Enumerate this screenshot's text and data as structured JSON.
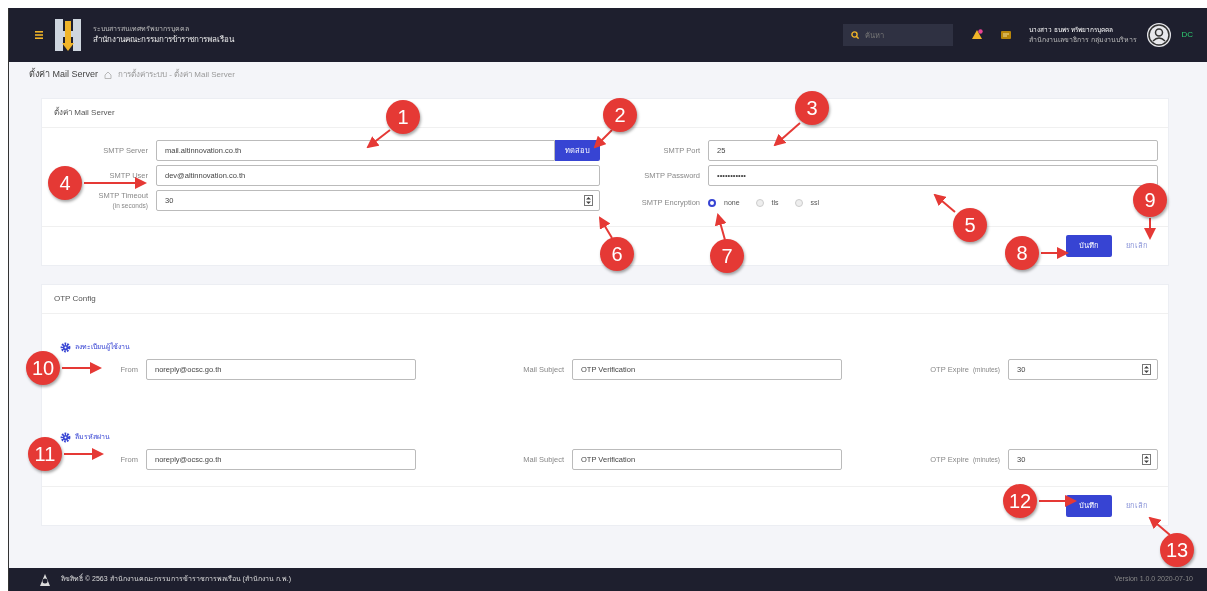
{
  "header": {
    "org_caption": "ระบบสารสนเทศทรัพยากรบุคคล",
    "org_name": "สำนักงานคณะกรรมการข้าราชการพลเรือน",
    "search": {
      "placeholder": "ค้นหา"
    },
    "user": {
      "name": "นางสาว ธนพร ทรัพยากรบุคคล",
      "unit": "สำนักงานเลขาธิการ กลุ่มงานบริหาร",
      "initials": "DC"
    }
  },
  "breadcrumb": {
    "title": "ตั้งค่า Mail Server",
    "path": "การตั้งค่าระบบ - ตั้งค่า Mail Server"
  },
  "mail_server": {
    "title": "ตั้งค่า Mail Server",
    "left_fields": [
      {
        "label": "SMTP Server",
        "value": "mail.altinnovation.co.th",
        "kind": "button",
        "button": "ทดสอบ"
      },
      {
        "label": "SMTP User",
        "value": "dev@altinnovation.co.th",
        "kind": "text"
      },
      {
        "label": "SMTP Timeout",
        "sublabel": "(in seconds)",
        "value": "30",
        "kind": "number"
      }
    ],
    "right_fields": [
      {
        "label": "SMTP Port",
        "value": "25",
        "kind": "text"
      },
      {
        "label": "SMTP Password",
        "value": "•••••••••••",
        "kind": "text"
      }
    ],
    "encryption": {
      "label": "SMTP Encryption",
      "options": [
        {
          "label": "none",
          "selected": true
        },
        {
          "label": "tls",
          "selected": false
        },
        {
          "label": "ssl",
          "selected": false
        }
      ]
    },
    "save": "บันทึก",
    "cancel": "ยกเลิก"
  },
  "otp_config": {
    "title": "OTP Config",
    "sections": [
      {
        "title": "ลงทะเบียนผู้ใช้งาน",
        "from_label": "From",
        "from": "noreply@ocsc.go.th",
        "subject_label": "Mail Subject",
        "subject": "OTP Verification",
        "expire_label": "OTP Expire",
        "expire_unit": "(minutes)",
        "expire": "30"
      },
      {
        "title": "ลืมรหัสผ่าน",
        "from_label": "From",
        "from": "noreply@ocsc.go.th",
        "subject_label": "Mail Subject",
        "subject": "OTP Verification",
        "expire_label": "OTP Expire",
        "expire_unit": "(minutes)",
        "expire": "30"
      }
    ],
    "save": "บันทึก",
    "cancel": "ยกเลิก"
  },
  "footer": {
    "copyright": "ลิขสิทธิ์ © 2563 สำนักงานคณะกรรมการข้าราชการพลเรือน (สำนักงาน ก.พ.)",
    "version": "Version 1.0.0 2020-07-10"
  },
  "annotations": [
    "1",
    "2",
    "3",
    "4",
    "5",
    "6",
    "7",
    "8",
    "9",
    "10",
    "11",
    "12",
    "13"
  ]
}
